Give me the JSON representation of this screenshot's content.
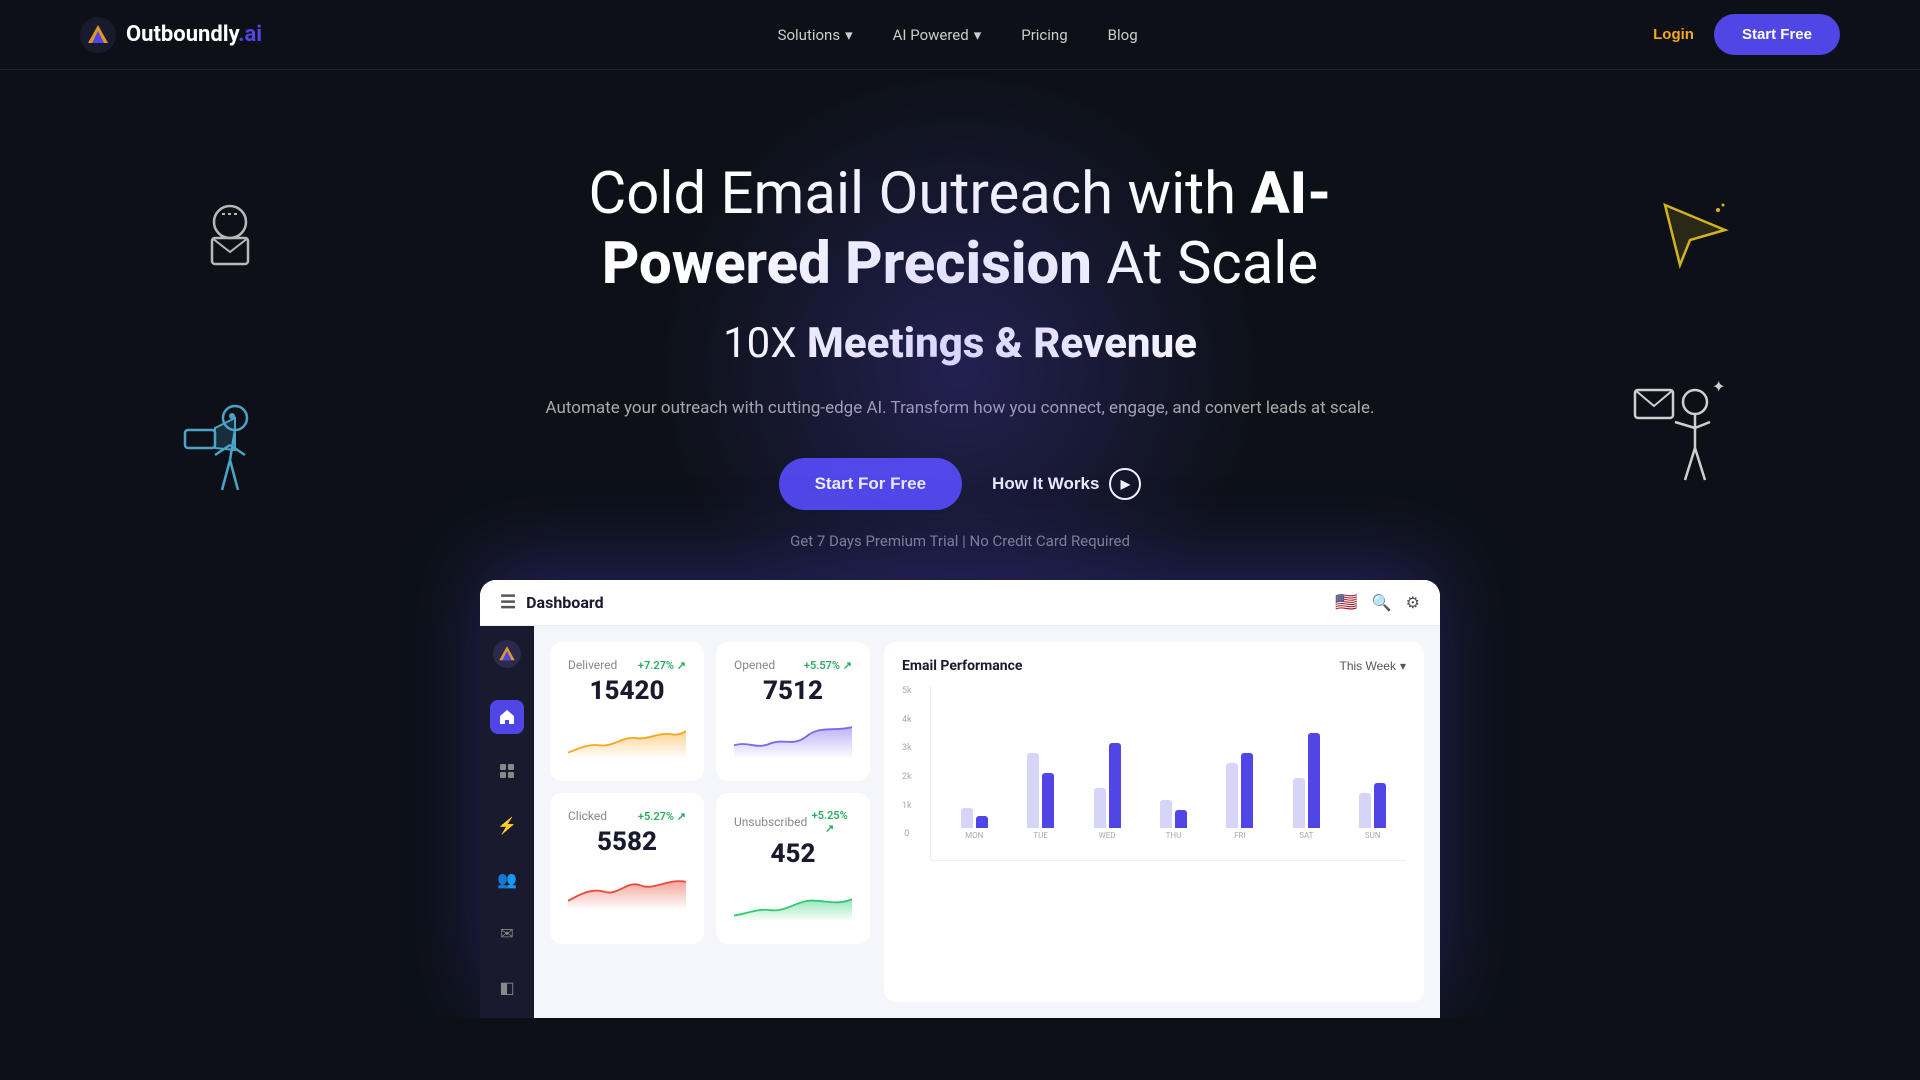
{
  "navbar": {
    "logo_text": "Outboundly",
    "logo_suffix": ".ai",
    "nav_items": [
      {
        "label": "Solutions",
        "has_dropdown": true
      },
      {
        "label": "AI Powered",
        "has_dropdown": true
      },
      {
        "label": "Pricing",
        "has_dropdown": false
      },
      {
        "label": "Blog",
        "has_dropdown": false
      }
    ],
    "login_label": "Login",
    "start_free_label": "Start Free"
  },
  "hero": {
    "title_part1": "Cold Email Outreach with ",
    "title_bold": "AI-Powered Precision",
    "title_part2": " At Scale",
    "subtitle_part1": "10X ",
    "subtitle_bold": "Meetings & Revenue",
    "description": "Automate your outreach with cutting-edge AI. Transform how you connect, engage, and convert leads at scale.",
    "cta_primary": "Start For Free",
    "cta_secondary": "How It Works",
    "trial_text": "Get 7 Days Premium Trial | No Credit Card Required"
  },
  "dashboard": {
    "title": "Dashboard",
    "this_week_label": "This Week",
    "stats": [
      {
        "label": "Delivered",
        "value": "15420",
        "change": "+7.27%",
        "color": "#f5a623",
        "sparkline_type": "orange"
      },
      {
        "label": "Opened",
        "value": "7512",
        "change": "+5.57%",
        "color": "#7b68ee",
        "sparkline_type": "purple"
      },
      {
        "label": "Clicked",
        "value": "5582",
        "change": "+5.27%",
        "color": "#e74c3c",
        "sparkline_type": "red"
      },
      {
        "label": "Unsubscribed",
        "value": "452",
        "change": "+5.25%",
        "color": "#2ecc71",
        "sparkline_type": "green"
      }
    ],
    "chart": {
      "title": "Email Performance",
      "y_labels": [
        "5k",
        "4k",
        "3k",
        "2k",
        "1k",
        "0"
      ],
      "x_labels": [
        "MON",
        "TUE",
        "WED",
        "THU",
        "FRI",
        "SAT",
        "SUN"
      ],
      "bars": [
        {
          "light": 20,
          "dark": 15
        },
        {
          "light": 80,
          "dark": 60
        },
        {
          "light": 45,
          "dark": 90
        },
        {
          "light": 30,
          "dark": 20
        },
        {
          "light": 70,
          "dark": 80
        },
        {
          "light": 55,
          "dark": 100
        },
        {
          "light": 40,
          "dark": 50
        }
      ]
    }
  }
}
